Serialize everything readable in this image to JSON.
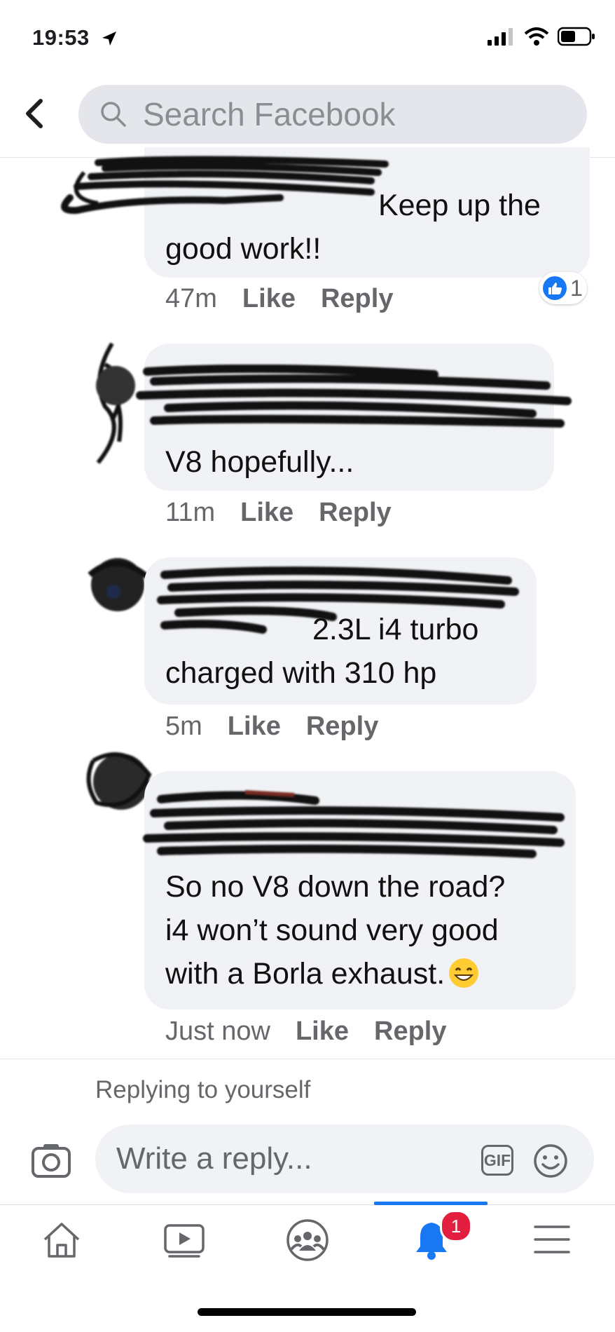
{
  "status_bar": {
    "time": "19:53"
  },
  "header": {
    "search_placeholder": "Search Facebook"
  },
  "comments": [
    {
      "text": "Keep up the good work!!",
      "time": "47m",
      "like": "Like",
      "reply": "Reply",
      "reaction_count": "1"
    },
    {
      "text": "V8 hopefully...",
      "time": "11m",
      "like": "Like",
      "reply": "Reply"
    },
    {
      "text_line1": "2.3L i4 turbo",
      "text_line2": "charged with 310 hp",
      "time": "5m",
      "like": "Like",
      "reply": "Reply"
    },
    {
      "text_line1": "So no V8 down the road?",
      "text_line2": "i4 won’t sound very good",
      "text_line3": "with a Borla exhaust.",
      "time": "Just now",
      "like": "Like",
      "reply": "Reply"
    }
  ],
  "composer": {
    "replying_label": "Replying to yourself",
    "placeholder": "Write a reply...",
    "gif_label": "GIF"
  },
  "tab_bar": {
    "notifications_badge": "1"
  },
  "colors": {
    "accent": "#1877f2",
    "badge": "#e41e3f",
    "bubble": "#f0f2f5"
  }
}
